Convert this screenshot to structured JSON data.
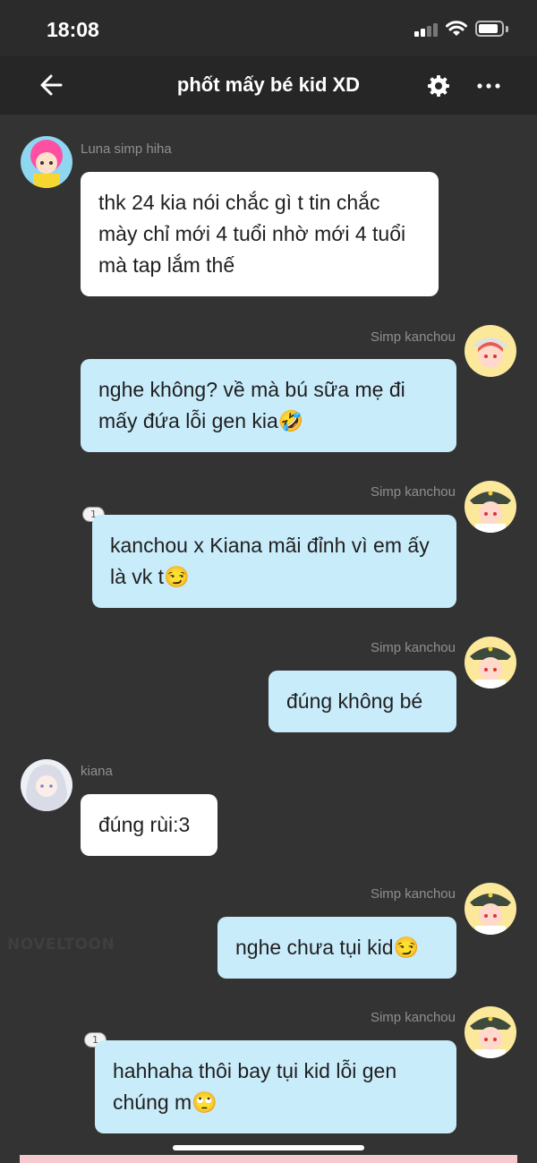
{
  "status_bar": {
    "time": "18:08"
  },
  "header": {
    "title": "phốt mấy bé kid XD"
  },
  "messages": [
    {
      "sender": "Luna simp hiha",
      "text": "thk 24 kia nói chắc gì t tin chắc mày chỉ mới 4 tuổi nhờ mới 4 tuổi mà tap lắm thế"
    },
    {
      "sender": "Simp kanchou",
      "text": "nghe không? về mà bú sữa mẹ đi mấy đứa lỗi gen kia🤣"
    },
    {
      "sender": "Simp kanchou",
      "reply_count": "1",
      "text": "kanchou x Kiana mãi đỉnh vì em ấy là vk t😏"
    },
    {
      "sender": "Simp kanchou",
      "text": "đúng không bé"
    },
    {
      "sender": "kiana",
      "text": "đúng rùi:3"
    },
    {
      "sender": "Simp kanchou",
      "text": "nghe chưa tụi kid😏"
    },
    {
      "sender": "Simp kanchou",
      "reply_count": "1",
      "text": "hahhaha thôi bay tụi kid lỗi gen chúng m🙄"
    }
  ],
  "watermark": "NOVELTOON",
  "colors": {
    "background": "#333333",
    "header": "#262626",
    "incoming_bubble": "#ffffff",
    "outgoing_bubble": "#c9ecfb"
  },
  "icons": [
    "back-arrow-icon",
    "gear-icon",
    "more-icon",
    "signal-icon",
    "wifi-icon",
    "battery-icon"
  ]
}
